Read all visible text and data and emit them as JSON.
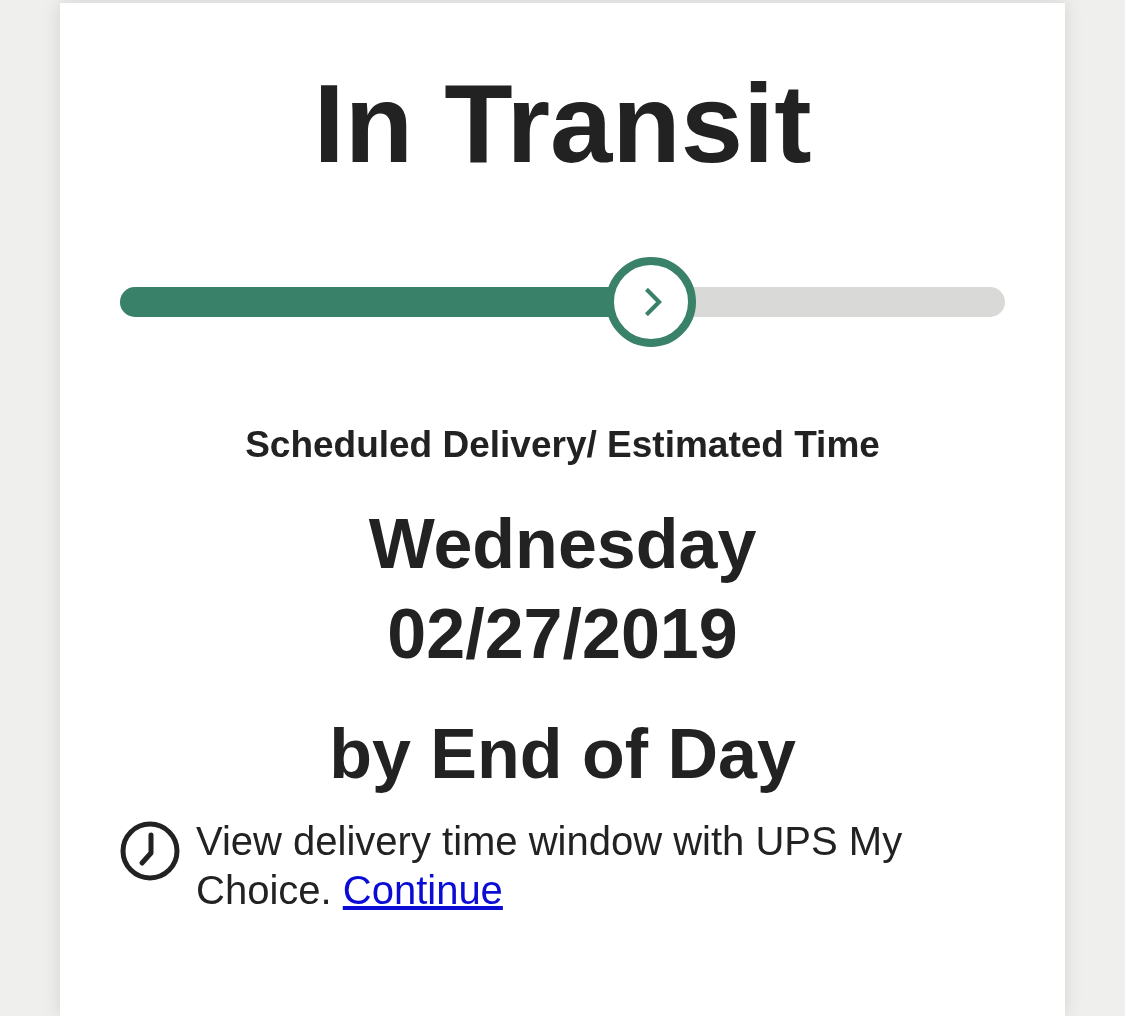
{
  "status": {
    "title": "In Transit"
  },
  "progress": {
    "level": 0.6
  },
  "delivery": {
    "label": "Scheduled Delivery/ Estimated Time",
    "day": "Wednesday",
    "date": "02/27/2019",
    "time": "by End of Day"
  },
  "notice": {
    "text": "View delivery time window with UPS My Choice.",
    "link": "Continue"
  }
}
